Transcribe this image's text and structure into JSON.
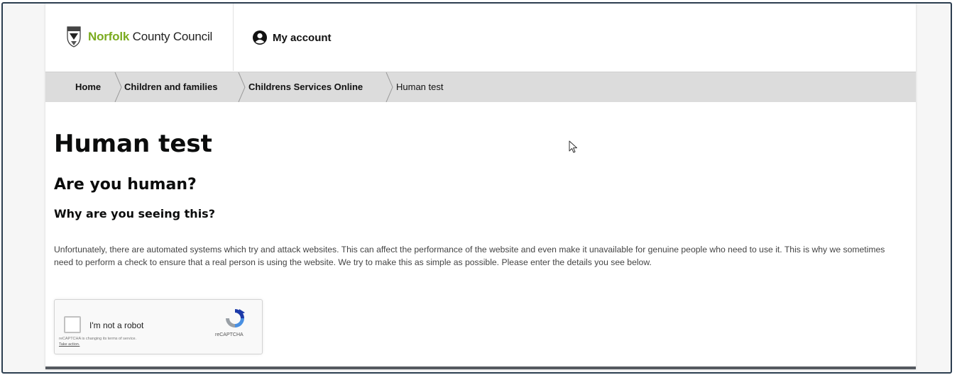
{
  "header": {
    "logo_brand": "Norfolk",
    "logo_rest": " County Council",
    "account_label": "My account"
  },
  "breadcrumb": {
    "items": [
      "Home",
      "Children and families",
      "Childrens Services Online",
      "Human test"
    ]
  },
  "main": {
    "title": "Human test",
    "subtitle": "Are you human?",
    "section_heading": "Why are you seeing this?",
    "paragraph": "Unfortunately, there are automated systems which try and attack websites. This can affect the performance of the website and even make it unavailable for genuine people who need to use it. This is why we sometimes need to perform a check to ensure that a real person is using the website. We try to make this as simple as possible. Please enter the details you see below."
  },
  "recaptcha": {
    "label": "I'm not a robot",
    "notice": "reCAPTCHA is changing its terms of service.",
    "action": "Take action.",
    "brand": "reCAPTCHA",
    "checked": false
  },
  "colors": {
    "brand_green": "#7bab1f",
    "breadcrumb_bg": "#dcdcdc",
    "frame_border": "#2c3e50"
  },
  "icons": {
    "crest": "norfolk-crest-icon",
    "account": "user-circle-icon",
    "recaptcha": "recaptcha-logo-icon",
    "cursor": "mouse-pointer-icon"
  }
}
